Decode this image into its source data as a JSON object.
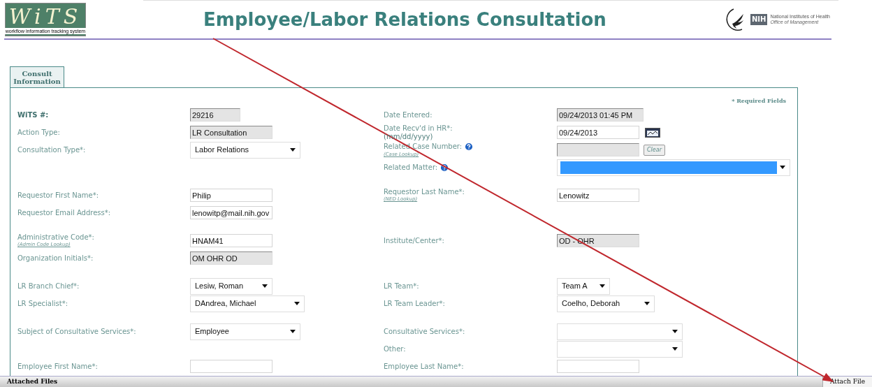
{
  "logo": {
    "name": "WiTS",
    "tagline": "workflow information tracking system"
  },
  "title": "Employee/Labor Relations Consultation",
  "agency_logo": {
    "badge": "NIH",
    "name": "National Institutes of Health",
    "subtitle": "Office of Management"
  },
  "tabs": [
    {
      "label": "Consult Information",
      "selected": true
    }
  ],
  "required_note": "* Required Fields",
  "groups": [
    [
      {
        "left": {
          "label": "WiTS #:",
          "kind": "input",
          "emphasis": true,
          "readonly": true,
          "value": "29216"
        },
        "right": {
          "label": "Date Entered:",
          "kind": "input",
          "readonly": true,
          "value": "09/24/2013 01:45 PM"
        }
      },
      {
        "left": {
          "label": "Action Type:",
          "kind": "input",
          "readonly": true,
          "value": "LR Consultation"
        },
        "right": {
          "label": "Date Recv'd in HR*:",
          "hint": "(mm/dd/yyyy)",
          "kind": "date",
          "readonly": false,
          "value": "09/24/2013"
        }
      },
      {
        "left": {
          "label": "Consultation Type*:",
          "kind": "select",
          "value": "Labor Relations"
        },
        "right": {
          "label": "Related Case Number:",
          "help": true,
          "lookup": "(Case Lookup)",
          "kind": "lookup",
          "readonly": true,
          "button": "Clear"
        }
      },
      {
        "right": {
          "label": "Related Matter:",
          "help": true,
          "kind": "select",
          "highlighted": true
        }
      }
    ],
    [
      {
        "left": {
          "label": "Requestor First Name*:",
          "kind": "input",
          "readonly": false,
          "value": "Philip"
        },
        "right": {
          "label": "Requestor Last Name*:",
          "lookup": "(NED Lookup)",
          "kind": "input",
          "readonly": false,
          "value": "Lenowitz"
        }
      },
      {
        "left": {
          "label": "Requestor Email Address*:",
          "kind": "input",
          "readonly": false,
          "value": "lenowitp@mail.nih.gov"
        }
      }
    ],
    [
      {
        "left": {
          "label": "Administrative Code*:",
          "lookup": "(Admin Code Lookup)",
          "kind": "input",
          "readonly": false,
          "value": "HNAM41"
        },
        "right": {
          "label": "Institute/Center*:",
          "kind": "input",
          "readonly": true,
          "value": "OD - OHR"
        }
      },
      {
        "left": {
          "label": "Organization Initials*:",
          "kind": "input",
          "readonly": true,
          "value": "OM OHR OD"
        }
      }
    ],
    [
      {
        "left": {
          "label": "LR Branch Chief*:",
          "kind": "select",
          "value": "Lesiw, Roman"
        },
        "right": {
          "label": "LR Team*:",
          "kind": "select",
          "value": "Team A"
        }
      },
      {
        "left": {
          "label": "LR Specialist*:",
          "kind": "select",
          "value": "DAndrea, Michael"
        },
        "right": {
          "label": "LR Team Leader*:",
          "kind": "select",
          "value": "Coelho, Deborah"
        }
      }
    ],
    [
      {
        "left": {
          "label": "Subject of Consultative Services*:",
          "kind": "select",
          "value": "Employee"
        },
        "right": {
          "label": "Consultative Services*:",
          "kind": "select"
        }
      },
      {
        "right": {
          "label": "Other:",
          "kind": "select"
        }
      },
      {
        "left": {
          "label": "Employee First Name*:",
          "kind": "input",
          "readonly": false
        },
        "right": {
          "label": "Employee Last Name*:",
          "kind": "input",
          "readonly": false
        }
      }
    ]
  ],
  "footer": {
    "label": "Attached Files",
    "button": "Attach File"
  }
}
